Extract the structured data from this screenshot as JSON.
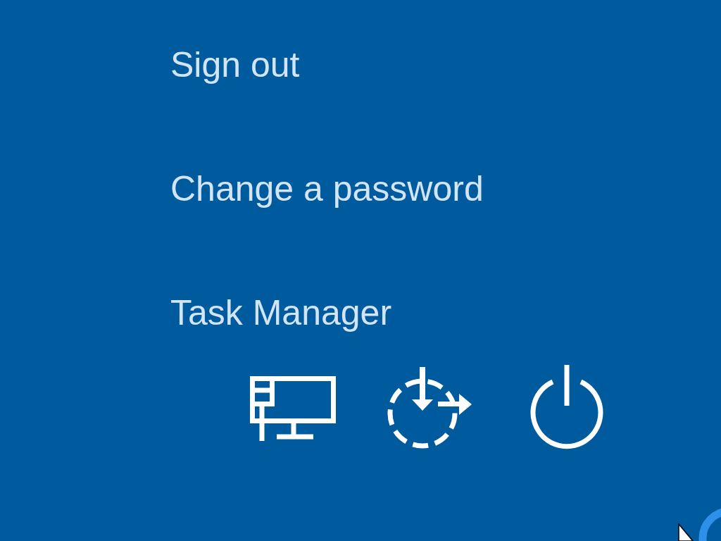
{
  "options": [
    {
      "label": "Sign out"
    },
    {
      "label": "Change a password"
    },
    {
      "label": "Task Manager"
    }
  ]
}
